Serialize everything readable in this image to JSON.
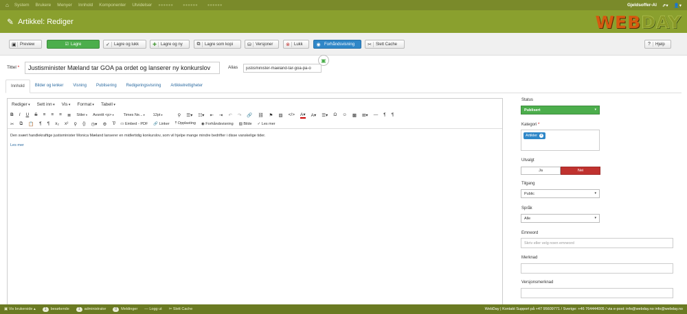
{
  "topnav": {
    "items": [
      "System",
      "Brukere",
      "Menyer",
      "Innhold",
      "Komponenter",
      "Utvidelser"
    ],
    "user": "Gjeldsoffer-AI"
  },
  "header": {
    "title": "Artikkel: Rediger"
  },
  "logo": {
    "part1": "WEB",
    "part2": "DAY"
  },
  "toolbar": {
    "preview": "Preview",
    "save": "Lagre",
    "save_close": "Lagre og lukk",
    "save_new": "Lagre og ny",
    "save_copy": "Lagre som kopi",
    "versions": "Versjoner",
    "close": "Lukk",
    "frontend_preview": "Forhåndsvisning",
    "clear_cache": "Slett Cache",
    "help": "Hjelp"
  },
  "article": {
    "title_label": "Tittel",
    "title_value": "Justisminister Mæland tar GOA pa ordet og lanserer ny konkurslov",
    "alias_label": "Alias",
    "alias_value": "justisminister-maeland-tar-goa-pa-o"
  },
  "tabs": [
    "Innhold",
    "Bilder og lenker",
    "Visning",
    "Publisering",
    "Redigeringsvisning",
    "Artikkelrettigheter"
  ],
  "editor": {
    "menus": [
      "Rediger",
      "Sett inn",
      "Vis",
      "Format",
      "Tabell"
    ],
    "styles": "Stiler",
    "paragraph": "Avsnitt <p>",
    "font": "Times Ne...",
    "size": "12pt",
    "embed_pdf": "Embed - PDF",
    "links": "Linker",
    "upload": "Opplasting",
    "preview": "Forhåndsvisning",
    "image": "Bilde",
    "readmore_btn": "Les mer",
    "body": "Den svært handlekraftige justisminister Monica Mæland lanserer en midlertidig konkurslov, som vil hjelpe mange mindre bedrifter i disse vanskelige tider.",
    "readmore": "Les mer"
  },
  "sidebar": {
    "status_label": "Status",
    "status_value": "Publisert",
    "category_label": "Kategori",
    "category_value": "Artikler",
    "featured_label": "Utvalgt",
    "featured_yes": "Ja",
    "featured_no": "Nei",
    "access_label": "Tilgang",
    "access_value": "Public",
    "language_label": "Språk",
    "language_value": "Alle",
    "tags_label": "Emneord",
    "tags_placeholder": "Skriv eller velg noen emneord",
    "note_label": "Merknad",
    "version_note_label": "Versjonsmerknad"
  },
  "statusbar": {
    "view_site": "Vis brukerside",
    "visitors_count": "1",
    "visitors": "besøkende",
    "admins_count": "1",
    "admins": "administrator",
    "messages_count": "0",
    "messages": "Meldinger",
    "logout": "Logg ut",
    "clear_cache": "Slett Cache",
    "contact": "WebDay | Kontakt Support på +47 95609771 / Sverige: +46 764444005 / via e-post: info@webday.no info@webday.no"
  }
}
